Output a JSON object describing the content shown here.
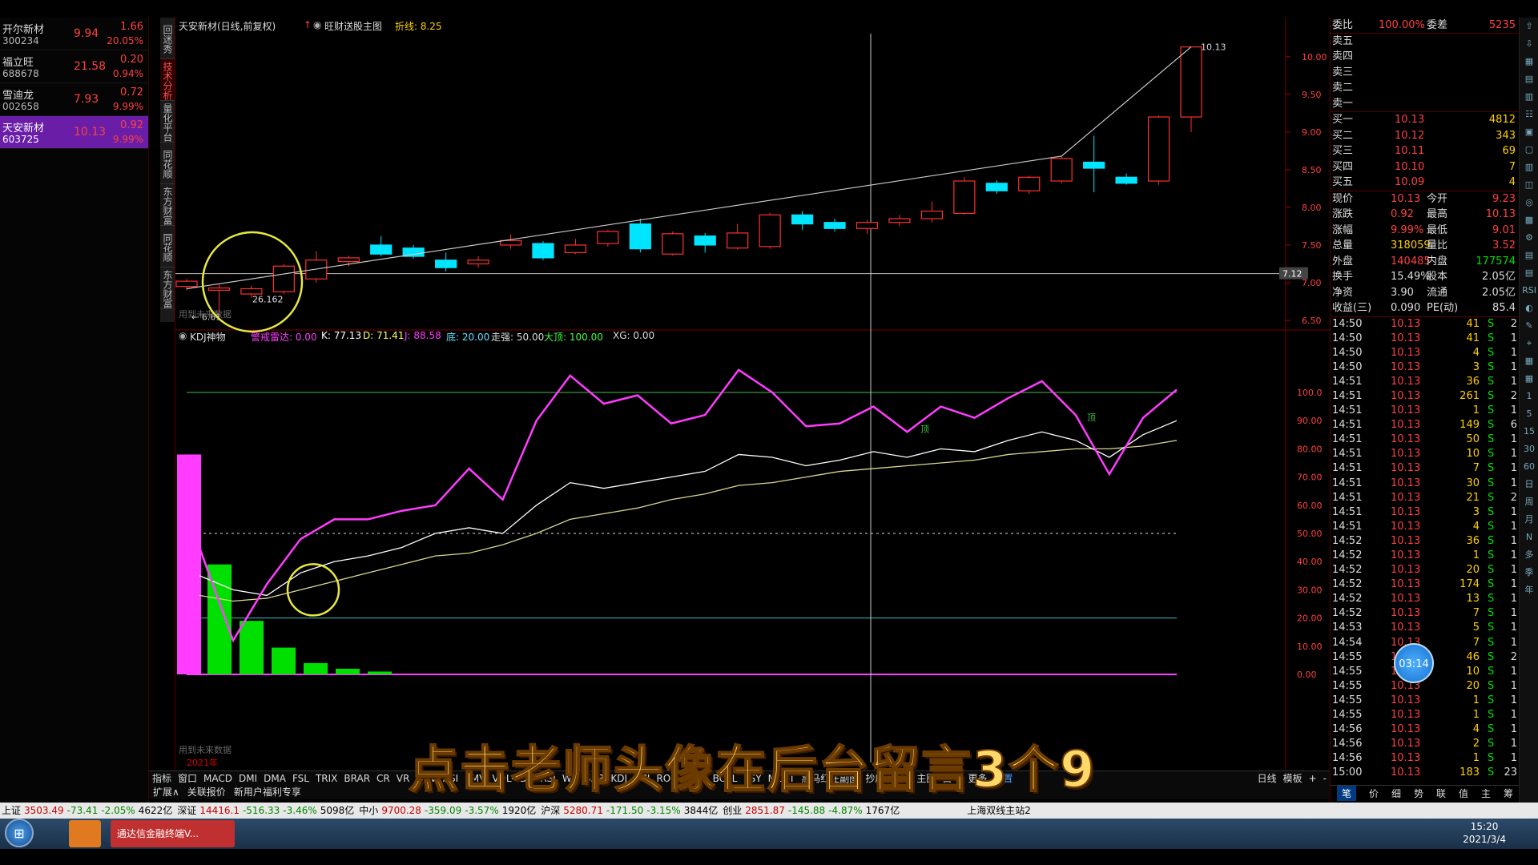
{
  "watchlist": [
    {
      "name": "开尔新材",
      "code": "300234",
      "price": "9.94",
      "change": "1.66",
      "pct": "20.05%"
    },
    {
      "name": "福立旺",
      "code": "688678",
      "price": "21.58",
      "change": "0.20",
      "pct": "0.94%"
    },
    {
      "name": "雪迪龙",
      "code": "002658",
      "price": "7.93",
      "change": "0.72",
      "pct": "9.99%"
    },
    {
      "name": "天安新材",
      "code": "603725",
      "price": "10.13",
      "change": "0.92",
      "pct": "9.99%"
    }
  ],
  "vtabs": [
    "回迷秀",
    "技术分析",
    "量化平台",
    "同花顺",
    "东方财富",
    "同花顺",
    "东方财富"
  ],
  "chart_header": {
    "title": "天安新材(日线,前复权)",
    "indicator": "旺财送股主图",
    "line_label": "折线: 8.25"
  },
  "kdj_header": {
    "name": "KDJ神物",
    "warn": "警戒雷达: 0.00",
    "k": "K: 77.13",
    "d": "D: 71.41",
    "j": "J: 88.58",
    "bottom": "底: 20.00",
    "trend": "走强: 50.00",
    "top": "大顶: 100.00",
    "xg": "XG: 0.00"
  },
  "price_axis": [
    "10.00",
    "9.50",
    "9.00",
    "8.50",
    "8.00",
    "7.50",
    "7.00",
    "6.50"
  ],
  "kdj_axis": [
    "100.0",
    "90.00",
    "80.00",
    "70.00",
    "60.00",
    "50.00",
    "40.00",
    "30.00",
    "20.00",
    "10.00",
    "0.00"
  ],
  "price_marker": "7.12",
  "annotations": {
    "high": "10.13",
    "low": "6.61",
    "mid": "26.162",
    "future1": "用到未来数据",
    "future2": "用到未来数据",
    "year": "2021年",
    "top_label": "顶",
    "top_label2": "顶"
  },
  "chart_data": {
    "type": "candlestick",
    "ylim": [
      6.5,
      10.2
    ],
    "candles": [
      [
        6.95,
        7.02,
        6.9,
        7.05
      ],
      [
        6.9,
        6.93,
        6.61,
        6.98
      ],
      [
        6.85,
        6.92,
        6.8,
        6.96
      ],
      [
        6.88,
        7.22,
        6.85,
        7.25
      ],
      [
        7.05,
        7.3,
        7.0,
        7.42
      ],
      [
        7.28,
        7.33,
        7.22,
        7.36
      ],
      [
        7.5,
        7.38,
        7.35,
        7.62
      ],
      [
        7.46,
        7.35,
        7.32,
        7.5
      ],
      [
        7.3,
        7.2,
        7.15,
        7.4
      ],
      [
        7.25,
        7.3,
        7.2,
        7.35
      ],
      [
        7.5,
        7.56,
        7.45,
        7.64
      ],
      [
        7.52,
        7.33,
        7.3,
        7.55
      ],
      [
        7.4,
        7.5,
        7.38,
        7.58
      ],
      [
        7.52,
        7.68,
        7.48,
        7.7
      ],
      [
        7.78,
        7.45,
        7.4,
        7.85
      ],
      [
        7.38,
        7.65,
        7.36,
        7.68
      ],
      [
        7.62,
        7.5,
        7.4,
        7.66
      ],
      [
        7.46,
        7.66,
        7.44,
        7.78
      ],
      [
        7.48,
        7.9,
        7.45,
        7.93
      ],
      [
        7.9,
        7.78,
        7.7,
        7.95
      ],
      [
        7.8,
        7.72,
        7.68,
        7.85
      ],
      [
        7.72,
        7.8,
        7.65,
        7.83
      ],
      [
        7.8,
        7.85,
        7.75,
        7.9
      ],
      [
        7.85,
        7.95,
        7.8,
        8.08
      ],
      [
        7.92,
        8.35,
        7.9,
        8.4
      ],
      [
        8.32,
        8.22,
        8.18,
        8.36
      ],
      [
        8.22,
        8.4,
        8.18,
        8.42
      ],
      [
        8.35,
        8.65,
        8.32,
        8.68
      ],
      [
        8.6,
        8.52,
        8.2,
        8.95
      ],
      [
        8.4,
        8.32,
        8.3,
        8.45
      ],
      [
        8.35,
        9.2,
        8.3,
        9.22
      ],
      [
        9.2,
        10.13,
        9.0,
        10.13
      ]
    ],
    "j": [
      45,
      12,
      32,
      48,
      55,
      55,
      58,
      60,
      73,
      62,
      90,
      106,
      96,
      99,
      89,
      92,
      108,
      100,
      88,
      89,
      95,
      86,
      95,
      91,
      98,
      104,
      92,
      71,
      91,
      101
    ],
    "k": [
      35,
      30,
      28,
      36,
      40,
      42,
      45,
      50,
      52,
      50,
      60,
      68,
      66,
      68,
      70,
      72,
      78,
      77,
      74,
      76,
      79,
      77,
      80,
      79,
      83,
      86,
      83,
      77,
      85,
      90
    ],
    "d": [
      28,
      26,
      27,
      30,
      33,
      36,
      39,
      42,
      43,
      46,
      50,
      55,
      57,
      59,
      62,
      64,
      67,
      68,
      70,
      72,
      73,
      74,
      75,
      76,
      78,
      79,
      80,
      80,
      81,
      83
    ],
    "bars_magenta": [
      78
    ],
    "bars_green": [
      39,
      19,
      9.5,
      4,
      2,
      1
    ]
  },
  "quote": {
    "webi": "委比",
    "webi_val": "100.00%",
    "weicha": "委差",
    "weicha_val": "5235",
    "sell": [
      {
        "l": "卖五"
      },
      {
        "l": "卖四"
      },
      {
        "l": "卖三"
      },
      {
        "l": "卖二"
      },
      {
        "l": "卖一"
      }
    ],
    "buy": [
      {
        "l": "买一",
        "p": "10.13",
        "v": "4812"
      },
      {
        "l": "买二",
        "p": "10.12",
        "v": "343"
      },
      {
        "l": "买三",
        "p": "10.11",
        "v": "69"
      },
      {
        "l": "买四",
        "p": "10.10",
        "v": "7"
      },
      {
        "l": "买五",
        "p": "10.09",
        "v": "4"
      }
    ],
    "stats": [
      {
        "a": "现价",
        "av": "10.13",
        "b": "今开",
        "bv": "9.23"
      },
      {
        "a": "涨跌",
        "av": "0.92",
        "b": "最高",
        "bv": "10.13"
      },
      {
        "a": "涨幅",
        "av": "9.99%",
        "b": "最低",
        "bv": "9.01"
      },
      {
        "a": "总量",
        "av": "318059",
        "b": "量比",
        "bv": "3.52"
      },
      {
        "a": "外盘",
        "av": "140485",
        "b": "内盘",
        "bv": "177574"
      },
      {
        "a": "换手",
        "av": "15.49%",
        "b": "股本",
        "bv": "2.05亿"
      },
      {
        "a": "净资",
        "av": "3.90",
        "b": "流通",
        "bv": "2.05亿"
      },
      {
        "a": "收益(三)",
        "av": "0.090",
        "b": "PE(动)",
        "bv": "85.4"
      }
    ],
    "ticks": [
      [
        "14:50",
        "10.13",
        "41",
        "S",
        "2"
      ],
      [
        "14:50",
        "10.13",
        "41",
        "S",
        "1"
      ],
      [
        "14:50",
        "10.13",
        "4",
        "S",
        "1"
      ],
      [
        "14:50",
        "10.13",
        "3",
        "S",
        "1"
      ],
      [
        "14:51",
        "10.13",
        "36",
        "S",
        "1"
      ],
      [
        "14:51",
        "10.13",
        "261",
        "S",
        "2"
      ],
      [
        "14:51",
        "10.13",
        "1",
        "S",
        "1"
      ],
      [
        "14:51",
        "10.13",
        "149",
        "S",
        "6"
      ],
      [
        "14:51",
        "10.13",
        "50",
        "S",
        "1"
      ],
      [
        "14:51",
        "10.13",
        "10",
        "S",
        "1"
      ],
      [
        "14:51",
        "10.13",
        "7",
        "S",
        "1"
      ],
      [
        "14:51",
        "10.13",
        "30",
        "S",
        "1"
      ],
      [
        "14:51",
        "10.13",
        "21",
        "S",
        "2"
      ],
      [
        "14:51",
        "10.13",
        "3",
        "S",
        "1"
      ],
      [
        "14:51",
        "10.13",
        "4",
        "S",
        "1"
      ],
      [
        "14:52",
        "10.13",
        "36",
        "S",
        "1"
      ],
      [
        "14:52",
        "10.13",
        "1",
        "S",
        "1"
      ],
      [
        "14:52",
        "10.13",
        "20",
        "S",
        "1"
      ],
      [
        "14:52",
        "10.13",
        "174",
        "S",
        "1"
      ],
      [
        "14:52",
        "10.13",
        "13",
        "S",
        "1"
      ],
      [
        "14:52",
        "10.13",
        "7",
        "S",
        "1"
      ],
      [
        "14:53",
        "10.13",
        "5",
        "S",
        "1"
      ],
      [
        "14:54",
        "10.13",
        "7",
        "S",
        "1"
      ],
      [
        "14:55",
        "10.13",
        "46",
        "S",
        "2"
      ],
      [
        "14:55",
        "10.13",
        "10",
        "S",
        "1"
      ],
      [
        "14:55",
        "10.13",
        "20",
        "S",
        "1"
      ],
      [
        "14:55",
        "10.13",
        "1",
        "S",
        "1"
      ],
      [
        "14:55",
        "10.13",
        "1",
        "S",
        "1"
      ],
      [
        "14:56",
        "10.13",
        "4",
        "S",
        "1"
      ],
      [
        "14:56",
        "10.13",
        "2",
        "S",
        "1"
      ],
      [
        "14:56",
        "10.13",
        "1",
        "S",
        "1"
      ],
      [
        "15:00",
        "10.13",
        "183",
        "S",
        "23"
      ]
    ],
    "bottom_tabs": [
      "笔",
      "价",
      "细",
      "势",
      "联",
      "值",
      "主",
      "筹"
    ]
  },
  "rside_icons": [
    "1",
    "5",
    "15",
    "30",
    "60",
    "日",
    "周",
    "月",
    "N",
    "多",
    "季",
    "年"
  ],
  "tabbar1": [
    "指标",
    "窗口",
    "MACD",
    "DMI",
    "DMA",
    "FSL",
    "TRIX",
    "BRAR",
    "CR",
    "VR",
    "OBV",
    "ASI",
    "EMV",
    "VOL-TDX",
    "RSI",
    "WR",
    "SAR",
    "KDJ",
    "CCI",
    "ROC",
    "MTM",
    "BOLL",
    "PSY",
    "MCST",
    "黑马红庄副图",
    "抄底",
    "马指",
    "主图",
    "白马",
    "更多",
    "设置"
  ],
  "tabbar1_right": [
    "日线",
    "模板",
    "+",
    "-"
  ],
  "tabbar2": [
    "扩展∧",
    "关联报价",
    "新用户福利专享"
  ],
  "status": [
    {
      "t": "上证",
      "v": "3503.49",
      "c": "-73.41",
      "p": "-2.05%",
      "a": "4622亿"
    },
    {
      "t": "深证",
      "v": "14416.1",
      "c": "-516.33",
      "p": "-3.46%",
      "a": "5098亿"
    },
    {
      "t": "中小",
      "v": "9700.28",
      "c": "-359.09",
      "p": "-3.57%",
      "a": "1920亿"
    },
    {
      "t": "沪深",
      "v": "5280.71",
      "c": "-171.50",
      "p": "-3.15%",
      "a": "3844亿"
    },
    {
      "t": "创业",
      "v": "2851.87",
      "c": "-145.88",
      "p": "-4.87%",
      "a": "1767亿"
    }
  ],
  "server": "上海双线主站2",
  "taskbar": {
    "app": "通达信金融终端V...",
    "time": "15:20",
    "date": "2021/3/4"
  },
  "subtitle": "点击老师头像在后台留言3个9",
  "timer": "03:14",
  "colors": {
    "up": "#ff4040",
    "down": "#00e5ff",
    "magenta": "#ff3cff",
    "green": "#00e000",
    "accent": "#c00000"
  }
}
